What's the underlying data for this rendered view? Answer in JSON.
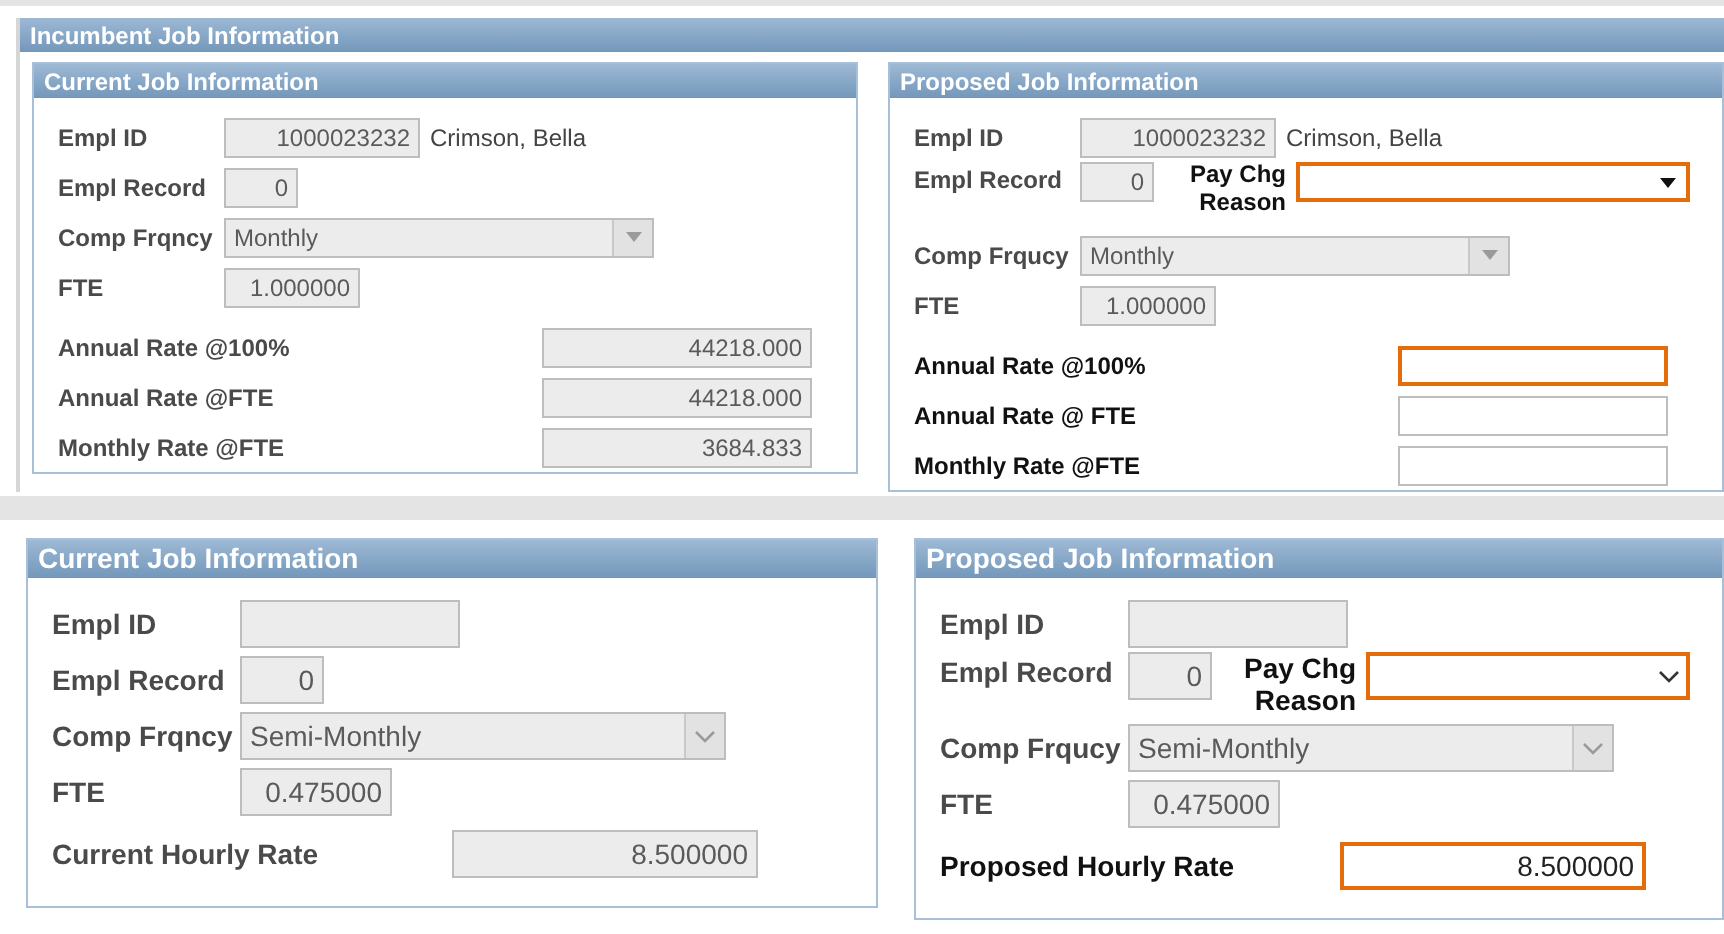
{
  "sections": [
    {
      "title": "Incumbent Job Information",
      "panels": [
        {
          "title": "Current Job Information",
          "rows": [
            {
              "kind": "id",
              "label": "Empl ID",
              "strong": false,
              "field": {
                "value": "1000023232",
                "disabled": true,
                "highlighted": false
              },
              "name": "Crimson, Bella"
            },
            {
              "kind": "record",
              "label": "Empl Record",
              "strong": false,
              "field": {
                "value": "0",
                "disabled": true,
                "highlighted": false
              }
            },
            {
              "kind": "frequency",
              "label": "Comp Frqncy",
              "strong": false,
              "field": {
                "kind": "dropdown",
                "value": "Monthly",
                "disabled": true,
                "highlighted": false
              }
            },
            {
              "kind": "fte",
              "label": "FTE",
              "strong": false,
              "field": {
                "value": "1.000000",
                "disabled": true,
                "highlighted": false
              }
            },
            {
              "kind": "rate",
              "label": "Annual Rate @100%",
              "strong": false,
              "field": {
                "value": "44218.000",
                "disabled": true,
                "highlighted": false
              }
            },
            {
              "kind": "rate",
              "label": "Annual Rate @FTE",
              "strong": false,
              "field": {
                "value": "44218.000",
                "disabled": true,
                "highlighted": false
              }
            },
            {
              "kind": "rate",
              "label": "Monthly Rate @FTE",
              "strong": false,
              "field": {
                "value": "3684.833",
                "disabled": true,
                "highlighted": false
              }
            }
          ]
        },
        {
          "title": "Proposed Job Information",
          "rows": [
            {
              "kind": "id",
              "label": "Empl ID",
              "strong": false,
              "field": {
                "value": "1000023232",
                "disabled": true,
                "highlighted": false
              },
              "name": "Crimson, Bella"
            },
            {
              "kind": "record",
              "label": "Empl Record",
              "strong": false,
              "field": {
                "value": "0",
                "disabled": true,
                "highlighted": false
              },
              "extra": {
                "label": "Pay Chg Reason",
                "field": {
                  "kind": "dropdown",
                  "disabled": false,
                  "highlighted": true
                }
              }
            },
            {
              "kind": "frequency",
              "label": "Comp Frqucy",
              "strong": false,
              "field": {
                "kind": "dropdown",
                "value": "Monthly",
                "disabled": true,
                "highlighted": false
              }
            },
            {
              "kind": "fte",
              "label": "FTE",
              "strong": false,
              "field": {
                "value": "1.000000",
                "disabled": true,
                "highlighted": false
              }
            },
            {
              "kind": "rate",
              "label": "Annual Rate @100%",
              "strong": true,
              "field": {
                "disabled": false,
                "highlighted": true
              }
            },
            {
              "kind": "rate",
              "label": "Annual Rate @ FTE",
              "strong": true,
              "field": {
                "disabled": false,
                "highlighted": false
              }
            },
            {
              "kind": "rate",
              "label": "Monthly Rate @FTE",
              "strong": true,
              "field": {
                "disabled": false,
                "highlighted": false
              }
            }
          ]
        }
      ]
    },
    {
      "panels": [
        {
          "title": "Current Job Information",
          "rows": [
            {
              "kind": "id",
              "label": "Empl ID",
              "strong": false,
              "field": {
                "disabled": true,
                "highlighted": false
              }
            },
            {
              "kind": "record",
              "label": "Empl Record",
              "strong": false,
              "field": {
                "value": "0",
                "disabled": true,
                "highlighted": false
              }
            },
            {
              "kind": "frequency",
              "label": "Comp Frqncy",
              "strong": false,
              "field": {
                "kind": "dropdown",
                "value": "Semi-Monthly",
                "disabled": true,
                "highlighted": false
              }
            },
            {
              "kind": "fte",
              "label": "FTE",
              "strong": false,
              "field": {
                "value": "0.475000",
                "disabled": true,
                "highlighted": false
              }
            },
            {
              "kind": "rate",
              "label": "Current Hourly Rate",
              "strong": false,
              "field": {
                "value": "8.500000",
                "disabled": true,
                "highlighted": false
              }
            }
          ]
        },
        {
          "title": "Proposed Job Information",
          "rows": [
            {
              "kind": "id",
              "label": "Empl ID",
              "strong": false,
              "field": {
                "disabled": true,
                "highlighted": false
              }
            },
            {
              "kind": "record",
              "label": "Empl Record",
              "strong": false,
              "field": {
                "value": "0",
                "disabled": true,
                "highlighted": false
              },
              "extra": {
                "label": "Pay Chg Reason",
                "field": {
                  "kind": "dropdown",
                  "disabled": false,
                  "highlighted": true
                }
              }
            },
            {
              "kind": "frequency",
              "label": "Comp Frqucy",
              "strong": false,
              "field": {
                "kind": "dropdown",
                "value": "Semi-Monthly",
                "disabled": true,
                "highlighted": false
              }
            },
            {
              "kind": "fte",
              "label": "FTE",
              "strong": false,
              "field": {
                "value": "0.475000",
                "disabled": true,
                "highlighted": false
              }
            },
            {
              "kind": "rate",
              "label": "Proposed Hourly Rate",
              "strong": true,
              "field": {
                "value": "8.500000",
                "disabled": false,
                "highlighted": true
              }
            }
          ]
        }
      ]
    }
  ]
}
